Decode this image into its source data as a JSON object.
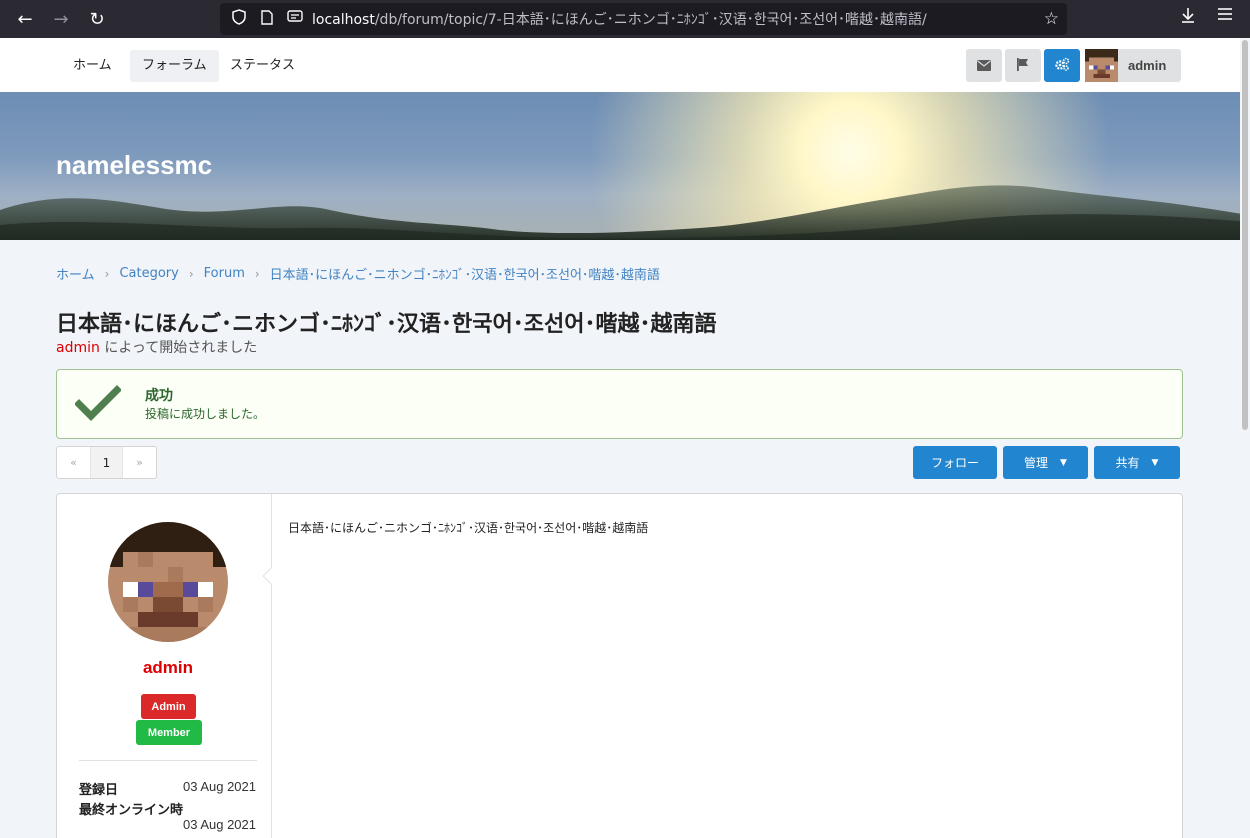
{
  "browser": {
    "url_host": "localhost",
    "url_path": "/db/forum/topic/7-日本語･にほんご･ニホンゴ･ﾆﾎﾝｺﾞ･汉语･한국어･조선어･喈越･越南語/"
  },
  "nav": {
    "items": [
      {
        "label": "ホーム"
      },
      {
        "label": "フォーラム"
      },
      {
        "label": "ステータス"
      }
    ],
    "user_name": "admin"
  },
  "banner": {
    "site_title": "namelessmc"
  },
  "breadcrumb": [
    {
      "label": "ホーム"
    },
    {
      "label": "Category"
    },
    {
      "label": "Forum"
    },
    {
      "label": "日本語･にほんご･ニホンゴ･ﾆﾎﾝｺﾞ･汉语･한국어･조선어･喈越･越南語"
    }
  ],
  "topic": {
    "title": "日本語･にほんご･ニホンゴ･ﾆﾎﾝｺﾞ･汉语･한국어･조선어･喈越･越南語",
    "author": "admin",
    "started_by_suffix": " によって開始されました"
  },
  "message": {
    "header": "成功",
    "body": "投稿に成功しました。"
  },
  "pagination": {
    "prev": "«",
    "current": "1",
    "next": "»"
  },
  "actions": {
    "follow": "フォロー",
    "manage": "管理",
    "share": "共有"
  },
  "post": {
    "author": "admin",
    "groups": [
      "Admin",
      "Member"
    ],
    "joined_label": "登録日",
    "joined_value": "03 Aug 2021",
    "last_online_label": "最終オンライン時",
    "last_online_value": "03 Aug 2021",
    "content": "日本語･にほんご･ニホンゴ･ﾆﾎﾝｺﾞ･汉语･한국어･조선어･喈越･越南語"
  },
  "colors": {
    "primary": "#2185d0",
    "admin_badge": "#db2828",
    "member_badge": "#21ba45",
    "username": "#dd0000",
    "link": "#4183c4"
  }
}
